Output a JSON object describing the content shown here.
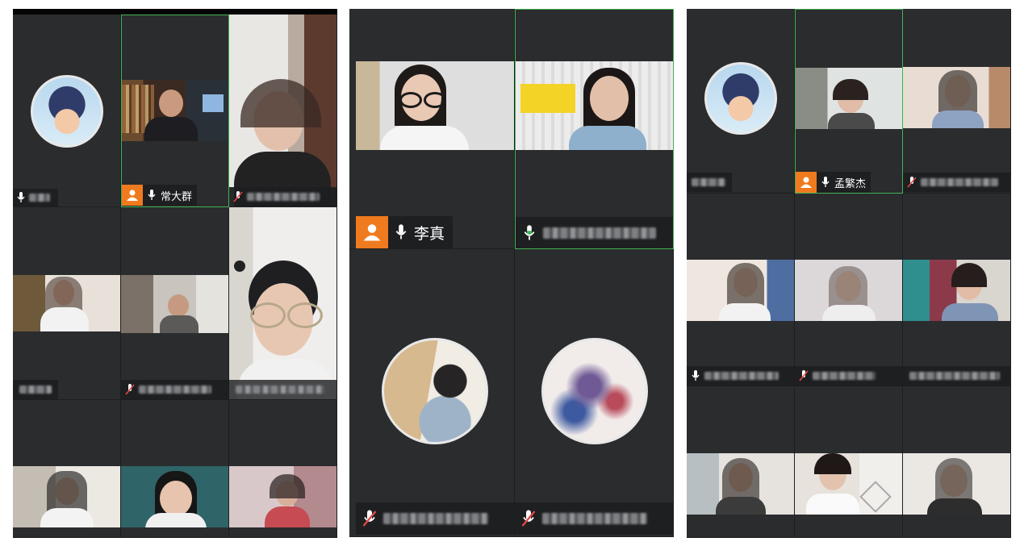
{
  "colors": {
    "tile": "#2b2c2e",
    "active_border": "#3fb452",
    "host_badge": "#f07a1e",
    "mic_active": "#3fb452",
    "mic_muted": "#e04848"
  },
  "panel1": {
    "tiles": [
      {
        "label": "",
        "host": false,
        "mic": "on"
      },
      {
        "label": "常大群",
        "host": true,
        "mic": "on",
        "active": true
      },
      {
        "label": "",
        "host": false,
        "mic": "muted"
      }
    ]
  },
  "panel2": {
    "tiles": [
      {
        "label": "李真",
        "host": true,
        "mic": "on"
      },
      {
        "label": "",
        "host": false,
        "mic": "active",
        "active": true
      },
      {
        "label": "",
        "host": false,
        "mic": "muted"
      },
      {
        "label": "",
        "host": false,
        "mic": "muted"
      }
    ]
  },
  "panel3": {
    "tiles": [
      {
        "label": "孟繁杰",
        "host": true,
        "mic": "on",
        "active": true
      }
    ]
  }
}
